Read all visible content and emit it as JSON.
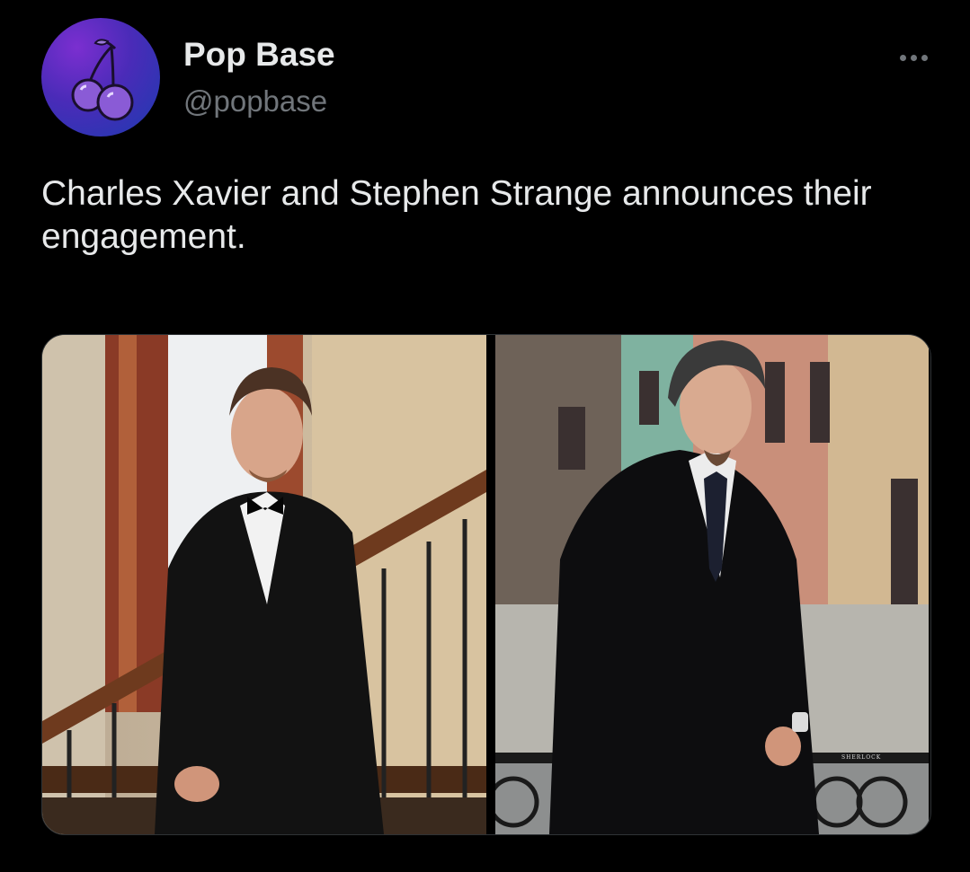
{
  "author": {
    "name": "Pop Base",
    "handle": "@popbase",
    "avatar_icon": "cherry-icon"
  },
  "menu": {
    "icon": "more-options-icon"
  },
  "tweet": {
    "text": "Charles Xavier and Stephen Strange announces their engagement."
  },
  "media": {
    "photos": [
      {
        "subject": "man-in-tuxedo-on-staircase"
      },
      {
        "subject": "man-in-dark-suit-on-street",
        "watermark": "SHERLOCK"
      }
    ]
  },
  "colors": {
    "background": "#000000",
    "text_primary": "#e7e9ea",
    "text_secondary": "#71767b",
    "avatar_gradient": [
      "#7b2fd0",
      "#1d3bb0"
    ]
  }
}
